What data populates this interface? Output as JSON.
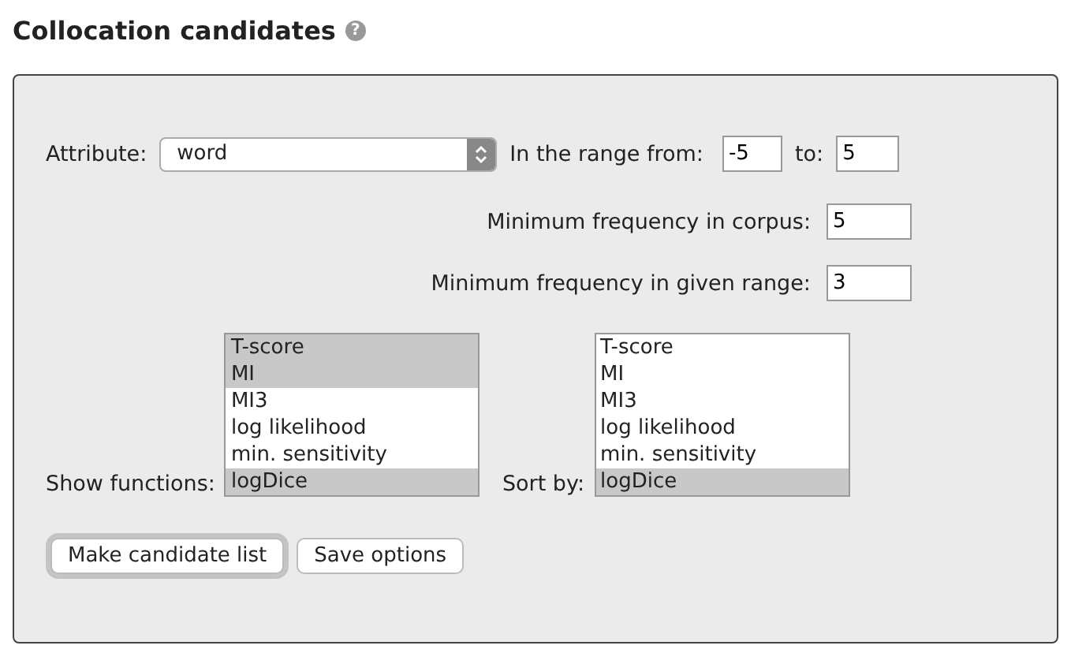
{
  "heading": {
    "title": "Collocation candidates",
    "help": "?"
  },
  "attribute": {
    "label": "Attribute:",
    "value": "word"
  },
  "range": {
    "label": "In the range from:",
    "from": "-5",
    "to_label": "to:",
    "to": "5"
  },
  "min_corpus": {
    "label": "Minimum frequency in corpus:",
    "value": "5"
  },
  "min_range": {
    "label": "Minimum frequency in given range:",
    "value": "3"
  },
  "show_functions": {
    "label": "Show functions:",
    "options": [
      {
        "label": "T-score",
        "selected": true
      },
      {
        "label": "MI",
        "selected": true
      },
      {
        "label": "MI3",
        "selected": false
      },
      {
        "label": "log likelihood",
        "selected": false
      },
      {
        "label": "min. sensitivity",
        "selected": false
      },
      {
        "label": "logDice",
        "selected": true
      }
    ]
  },
  "sort_by": {
    "label": "Sort by:",
    "options": [
      {
        "label": "T-score",
        "selected": false
      },
      {
        "label": "MI",
        "selected": false
      },
      {
        "label": "MI3",
        "selected": false
      },
      {
        "label": "log likelihood",
        "selected": false
      },
      {
        "label": "min. sensitivity",
        "selected": false
      },
      {
        "label": "logDice",
        "selected": true
      }
    ]
  },
  "buttons": [
    {
      "label": "Make candidate list",
      "default": true
    },
    {
      "label": "Save options",
      "default": false
    }
  ]
}
